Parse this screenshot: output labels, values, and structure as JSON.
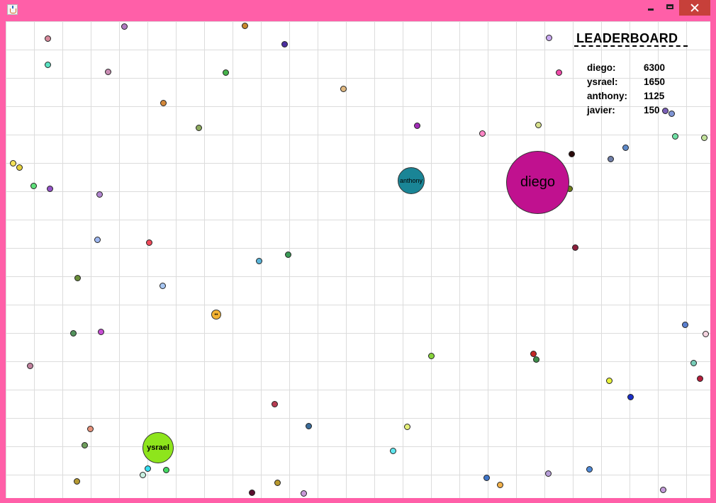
{
  "window": {
    "bg_color": "#ff5fa8",
    "icon": "java-cup-icon",
    "controls": [
      "minimize",
      "maximize",
      "close"
    ]
  },
  "game": {
    "bg_color": "#ffffff",
    "grid_color": "#dcdcdc",
    "players": [
      {
        "name": "diego",
        "color": "#c0118f"
      },
      {
        "name": "anthony",
        "color": "#1a8596"
      },
      {
        "name": "ysrael",
        "color": "#8ee51c"
      }
    ],
    "pellet_count": 84
  },
  "leaderboard": {
    "title": "LEADERBOARD",
    "entries": [
      {
        "name": "diego:",
        "score": "6300"
      },
      {
        "name": "ysrael:",
        "score": "1650"
      },
      {
        "name": "anthony:",
        "score": "1125"
      },
      {
        "name": "javier:",
        "score": "150"
      }
    ]
  }
}
